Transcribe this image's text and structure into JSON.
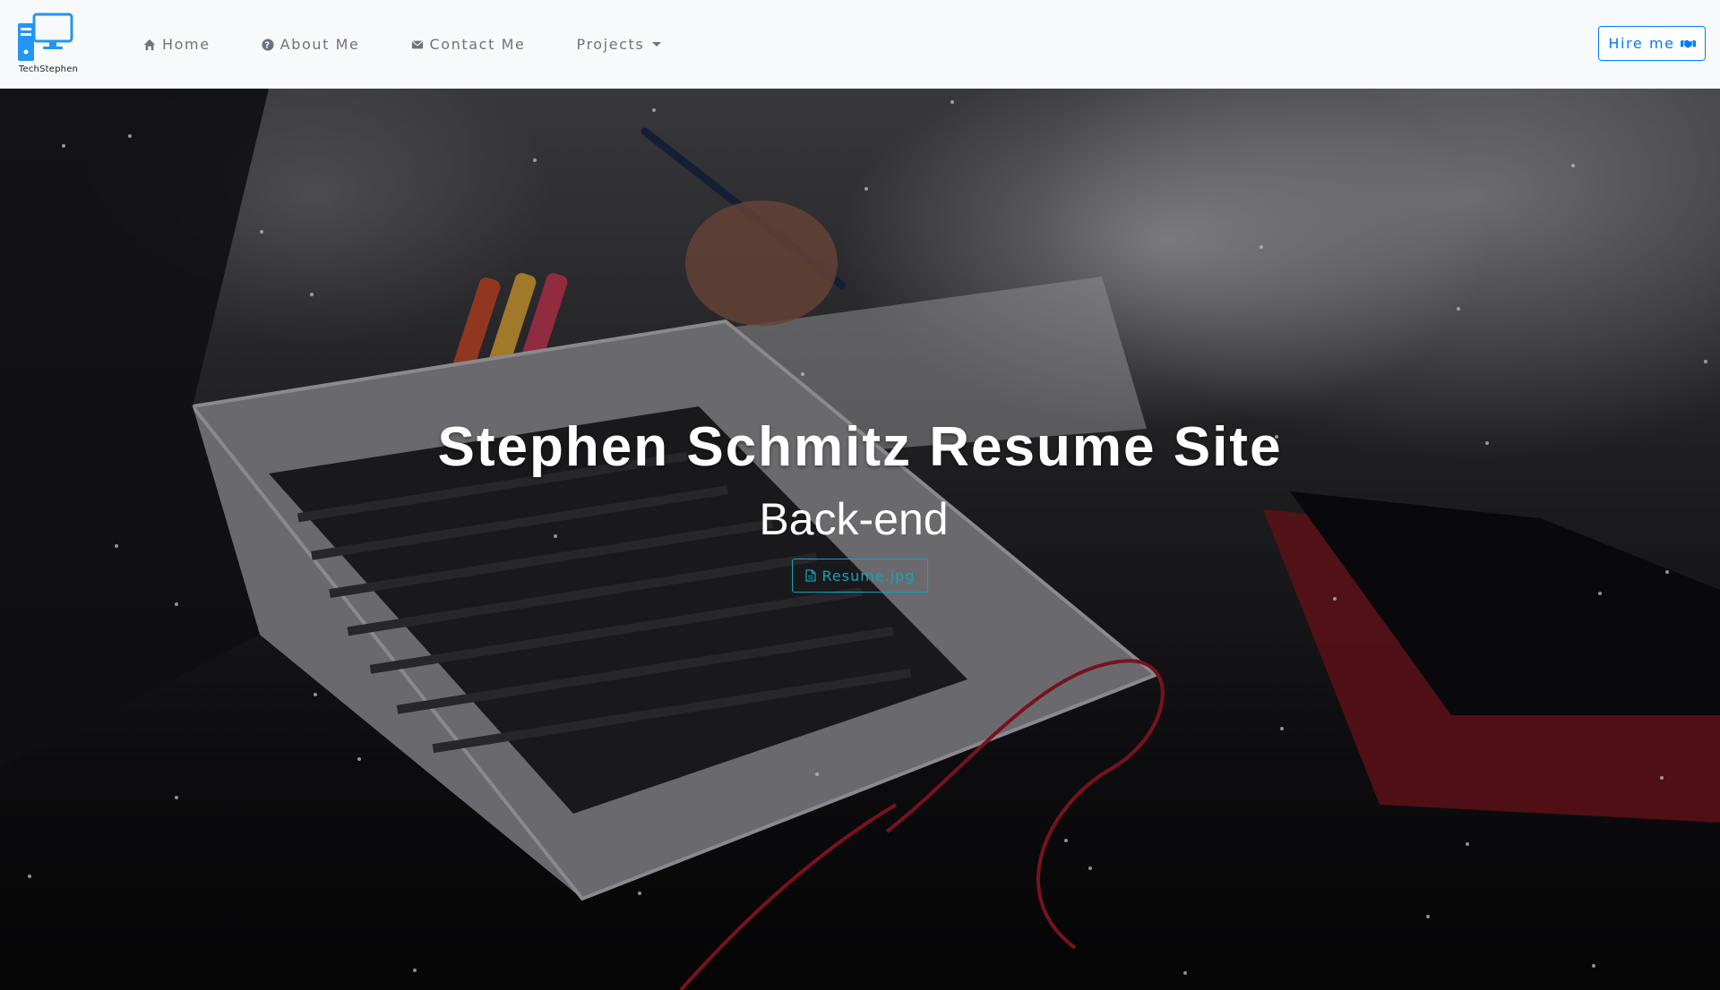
{
  "brand": {
    "name": "TechStephen",
    "logo_icon": "computer-monitor-icon",
    "accent": "#2196f3"
  },
  "nav": {
    "items": [
      {
        "label": "Home",
        "icon": "home-icon"
      },
      {
        "label": "About Me",
        "icon": "question-circle-icon"
      },
      {
        "label": "Contact Me",
        "icon": "envelope-icon"
      },
      {
        "label": "Projects",
        "icon": "dropdown-caret-icon"
      }
    ],
    "hire_button": {
      "label": "Hire me",
      "icon": "handshake-icon"
    }
  },
  "hero": {
    "title": "Stephen Schmitz Resume Site",
    "subtitle": "Back-end",
    "resume_button": {
      "label": "Resume.jpg",
      "icon": "file-icon"
    },
    "background_description_icon": "laptop-desk-photo"
  },
  "colors": {
    "primary": "#007bff",
    "info": "#17a2b8",
    "navbar_bg": "#f8f9fa",
    "nav_text": "#6c757d"
  }
}
